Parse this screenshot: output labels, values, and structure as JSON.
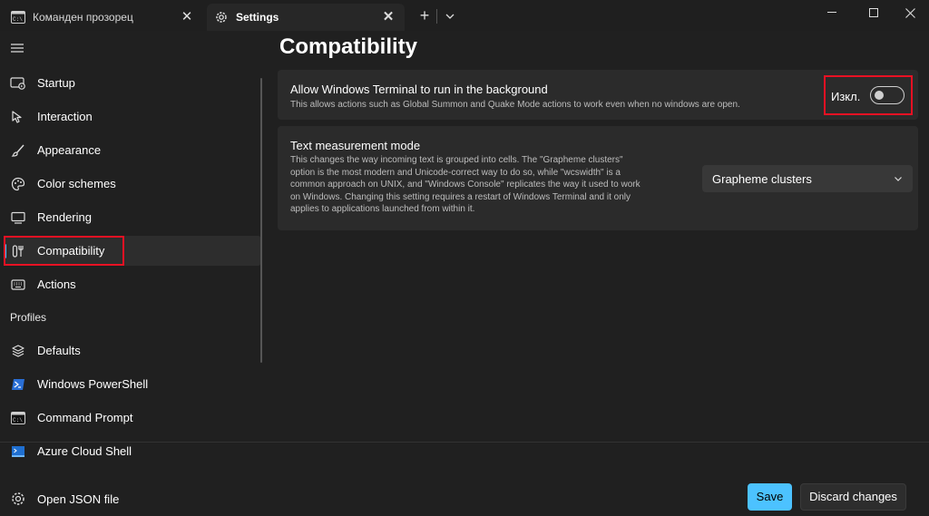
{
  "tabs": [
    {
      "label": "Команден прозорец",
      "icon": "terminal-icon"
    },
    {
      "label": "Settings",
      "icon": "gear-icon"
    }
  ],
  "sidebar": {
    "items": [
      {
        "label": "Startup",
        "icon": "startup-icon"
      },
      {
        "label": "Interaction",
        "icon": "interaction-icon"
      },
      {
        "label": "Appearance",
        "icon": "brush-icon"
      },
      {
        "label": "Color schemes",
        "icon": "palette-icon"
      },
      {
        "label": "Rendering",
        "icon": "monitor-icon"
      },
      {
        "label": "Compatibility",
        "icon": "compatibility-icon",
        "selected": true
      },
      {
        "label": "Actions",
        "icon": "keyboard-icon"
      }
    ],
    "profiles_header": "Profiles",
    "profiles": [
      {
        "label": "Defaults",
        "icon": "layers-icon"
      },
      {
        "label": "Windows PowerShell",
        "icon": "powershell-icon"
      },
      {
        "label": "Command Prompt",
        "icon": "cmd-icon"
      },
      {
        "label": "Azure Cloud Shell",
        "icon": "azure-icon"
      }
    ],
    "open_json": {
      "label": "Open JSON file",
      "icon": "gear-icon"
    }
  },
  "main": {
    "title": "Compatibility",
    "background_setting": {
      "title": "Allow Windows Terminal to run in the background",
      "description": "This allows actions such as Global Summon and Quake Mode actions to work even when no windows are open.",
      "toggle_label": "Изкл.",
      "toggle_on": false
    },
    "text_measurement": {
      "title": "Text measurement mode",
      "description_lines": [
        "This changes the way incoming text is grouped into cells. The \"Grapheme clusters\"",
        "option is the most modern and Unicode-correct way to do so, while \"wcswidth\" is a",
        "common approach on UNIX, and \"Windows Console\" replicates the way it used to work",
        "on Windows. Changing this setting requires a restart of Windows Terminal and it only",
        "applies to applications launched from within it."
      ],
      "selected_value": "Grapheme clusters"
    }
  },
  "footer": {
    "save_label": "Save",
    "discard_label": "Discard changes"
  },
  "colors": {
    "accent": "#4cc2ff",
    "highlight_box": "#e81123",
    "background": "#202020",
    "card": "#2b2b2b"
  }
}
